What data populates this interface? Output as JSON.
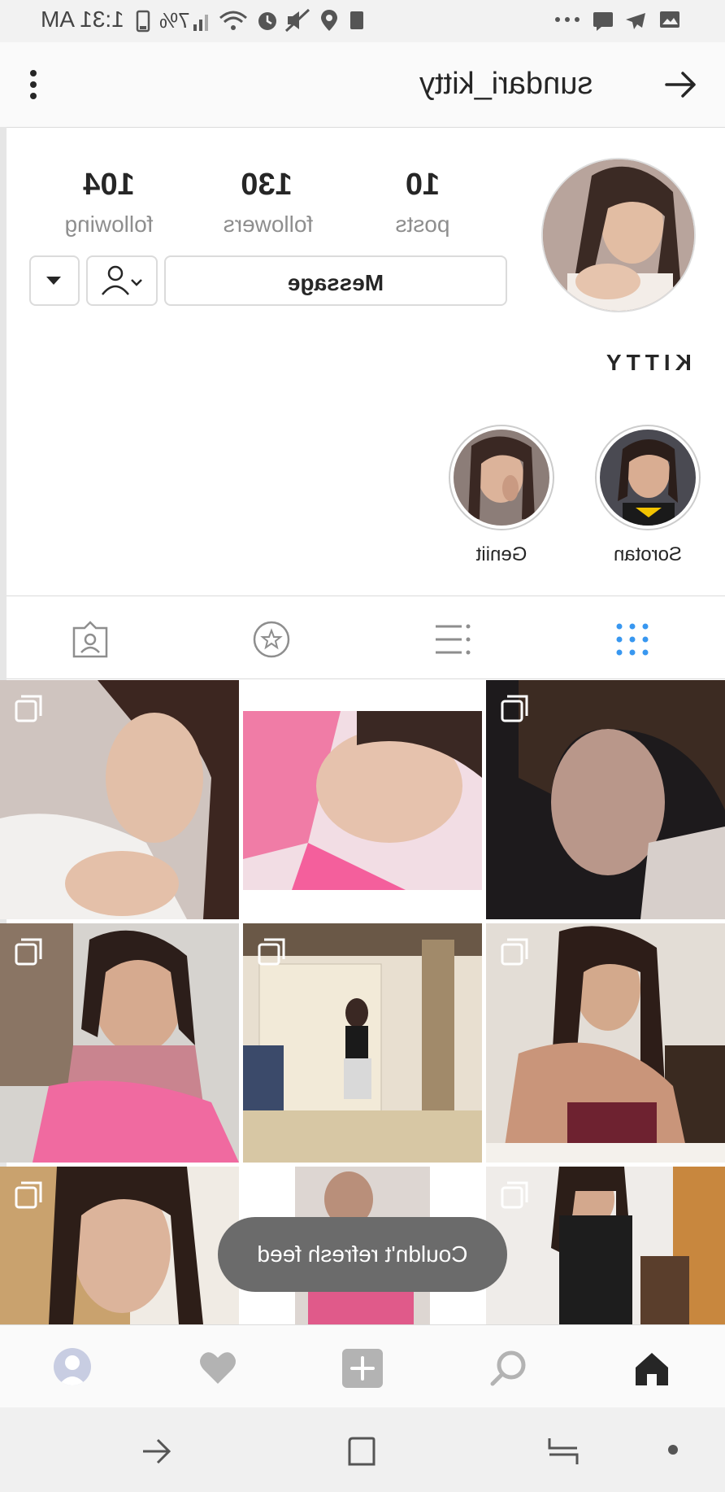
{
  "status_bar": {
    "time": "1:31 AM",
    "battery": "7%"
  },
  "header": {
    "username": "sundari_kitty"
  },
  "profile": {
    "stats": [
      {
        "value": "10",
        "label": "posts"
      },
      {
        "value": "130",
        "label": "followers"
      },
      {
        "value": "104",
        "label": "following"
      }
    ],
    "message_label": "Message",
    "full_name": "KITTY"
  },
  "highlights": [
    {
      "label": "Sorotan"
    },
    {
      "label": "Geniit"
    }
  ],
  "tabs": [
    "grid-icon",
    "list-icon",
    "star-icon",
    "tagged-icon"
  ],
  "toast": "Couldn't refresh feed",
  "bottom_nav": [
    "home-icon",
    "search-icon",
    "add-icon",
    "heart-icon",
    "profile-icon"
  ],
  "colors": {
    "accent": "#3897f0",
    "bg": "#fafafa",
    "border": "#dbdbdb",
    "muted": "#8e8e8e"
  }
}
